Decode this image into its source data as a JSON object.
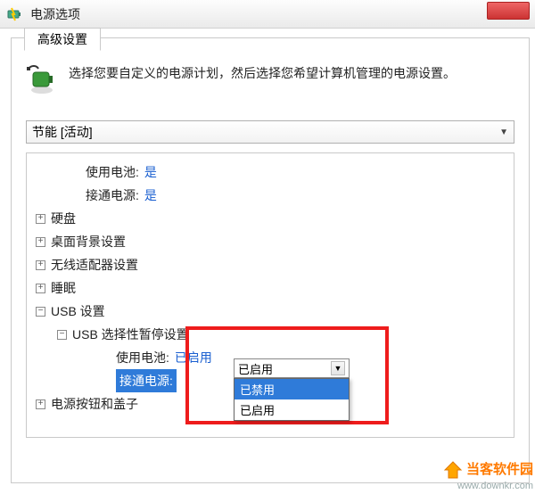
{
  "window": {
    "title": "电源选项"
  },
  "tab": {
    "label": "高级设置"
  },
  "description": "选择您要自定义的电源计划，然后选择您希望计算机管理的电源设置。",
  "plan_combo": {
    "selected": "节能 [活动]"
  },
  "tree": {
    "row_battery": {
      "label": "使用电池:",
      "value": "是"
    },
    "row_ac": {
      "label": "接通电源:",
      "value": "是"
    },
    "hdd": {
      "label": "硬盘"
    },
    "bg": {
      "label": "桌面背景设置"
    },
    "wifi": {
      "label": "无线适配器设置"
    },
    "sleep": {
      "label": "睡眠"
    },
    "usb": {
      "label": "USB 设置"
    },
    "usb_sel": {
      "label": "USB 选择性暂停设置"
    },
    "usb_batt": {
      "label": "使用电池:",
      "value": "已启用"
    },
    "usb_ac": {
      "label": "接通电源:"
    },
    "power_btn": {
      "label": "电源按钮和盖子"
    }
  },
  "dropdown": {
    "current": "已启用",
    "opt_disabled": "已禁用",
    "opt_enabled": "已启用"
  },
  "watermark": {
    "name": "当客软件园",
    "url": "www.downkr.com"
  }
}
